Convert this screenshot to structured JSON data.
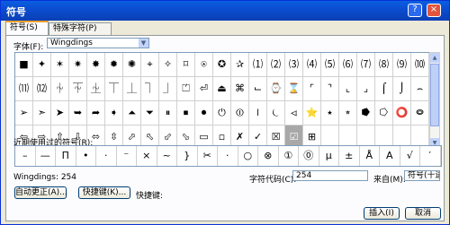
{
  "window": {
    "title": "符号",
    "help": "?",
    "close": "×"
  },
  "tabs": [
    {
      "label": "符号(S)"
    },
    {
      "label": "特殊字符(P)"
    }
  ],
  "font": {
    "label": "字体(F):",
    "value": "Wingdings",
    "dropdown_icon": "▼"
  },
  "grid": {
    "rows": [
      [
        "■",
        "✦",
        "✶",
        "✷",
        "✸",
        "✹",
        "✺",
        "⌖",
        "✧",
        "⌑",
        "⍟",
        "✪",
        "✰",
        "⑴",
        "⑵",
        "⑶",
        "⑷",
        "⑸",
        "⑹",
        "⑺",
        "⑻",
        "⑼",
        "⑽"
      ],
      [
        "⑾",
        "⑿",
        "⏆",
        "⏇",
        "⏈",
        "⏉",
        "⏊",
        "⏋",
        "⏌",
        "⏍",
        "⏎",
        "⏏",
        "⌘",
        "⌙",
        "⌚",
        "⌛",
        "⌜",
        "⌝",
        "⌞",
        "⌟",
        "⌠",
        "⌡",
        "⌢"
      ],
      [
        "➢",
        "➣",
        "➤",
        "➥",
        "➦",
        "➧",
        "⏶",
        "⏷",
        "⏸",
        "⏹",
        "⏺",
        "⏻",
        "⏼",
        "⏽",
        "⏾",
        "⏿",
        "⭐",
        "⭑",
        "⭒",
        "⭓",
        "⭔",
        "⭕",
        "⭖"
      ],
      [
        "⇦",
        "⇨",
        "⇧",
        "⇩",
        "⬄",
        "⇳",
        "⬀",
        "⬁",
        "⬃",
        "⬂",
        "▭",
        "▫",
        "✗",
        "✓",
        "☒",
        "☑",
        "⊞",
        "",
        "",
        "",
        "",
        "",
        ""
      ]
    ],
    "selected_row": 3,
    "selected_col": 15
  },
  "scroll": {
    "up": "▲",
    "down": "▼"
  },
  "recent": {
    "label": "近期使用过的符号(R):",
    "items": [
      "–",
      "—",
      "Π",
      "•",
      "·",
      "⁻",
      "×",
      "~",
      "}",
      "✂",
      "·",
      "○",
      "⊗",
      "①",
      "⓪",
      "μ",
      "±",
      "Å",
      "A",
      "√",
      "′"
    ]
  },
  "info": {
    "font_info": "Wingdings: 254",
    "charcode_label": "字符代码(C):",
    "charcode_value": "254",
    "from_label": "来自(M):",
    "from_value": "符号(十进制)"
  },
  "buttons": {
    "autocorrect": "自动更正(A)...",
    "shortcut": "快捷键(K)...",
    "shortcut_label": "快捷键:",
    "insert": "插入(I)",
    "cancel": "取消"
  }
}
